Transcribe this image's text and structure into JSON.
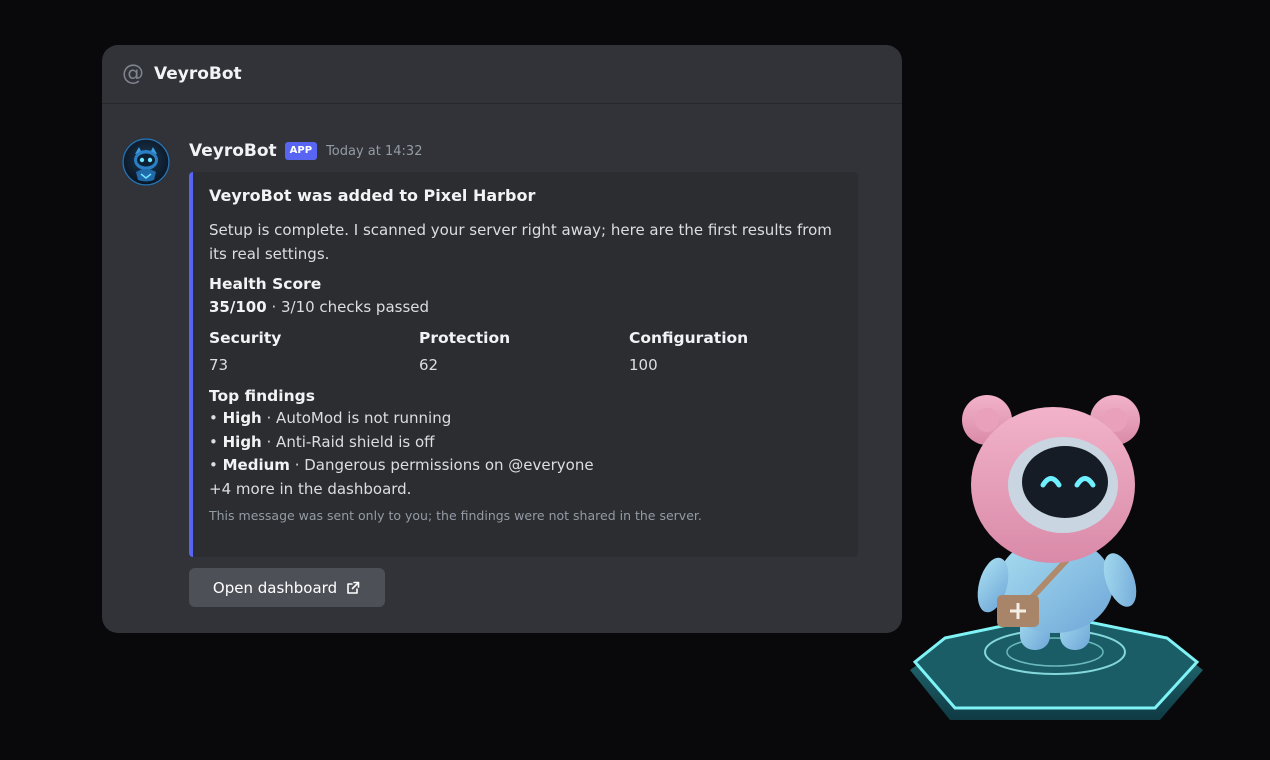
{
  "channel": {
    "icon": "at-icon",
    "name": "VeyroBot"
  },
  "message": {
    "author": "VeyroBot",
    "badge": "APP",
    "timestamp": "Today at 14:32",
    "avatar_icon": "robot-avatar-icon"
  },
  "embed": {
    "accent_color": "#5865f2",
    "title": "VeyroBot was added to Pixel Harbor",
    "description": "Setup is complete. I scanned your server right away; here are the first results from its real settings.",
    "health": {
      "name": "Health Score",
      "score": "35/100",
      "detail": " · 3/10 checks passed"
    },
    "fields": [
      {
        "name": "Security",
        "value": "73"
      },
      {
        "name": "Protection",
        "value": "62"
      },
      {
        "name": "Configuration",
        "value": "100"
      }
    ],
    "findings": {
      "name": "Top findings",
      "items": [
        {
          "severity": "High",
          "text": " · AutoMod is not running"
        },
        {
          "severity": "High",
          "text": " · Anti-Raid shield is off"
        },
        {
          "severity": "Medium",
          "text": " · Dangerous permissions on @everyone"
        }
      ],
      "more": "+4 more in the dashboard."
    },
    "footer": "This message was sent only to you; the findings were not shared in the server."
  },
  "button": {
    "label": "Open dashboard",
    "icon": "external-link-icon"
  },
  "colors": {
    "background": "#09090b",
    "card": "#313338",
    "embed": "#2b2d31",
    "blurple": "#5865f2",
    "button": "#4e5058"
  }
}
